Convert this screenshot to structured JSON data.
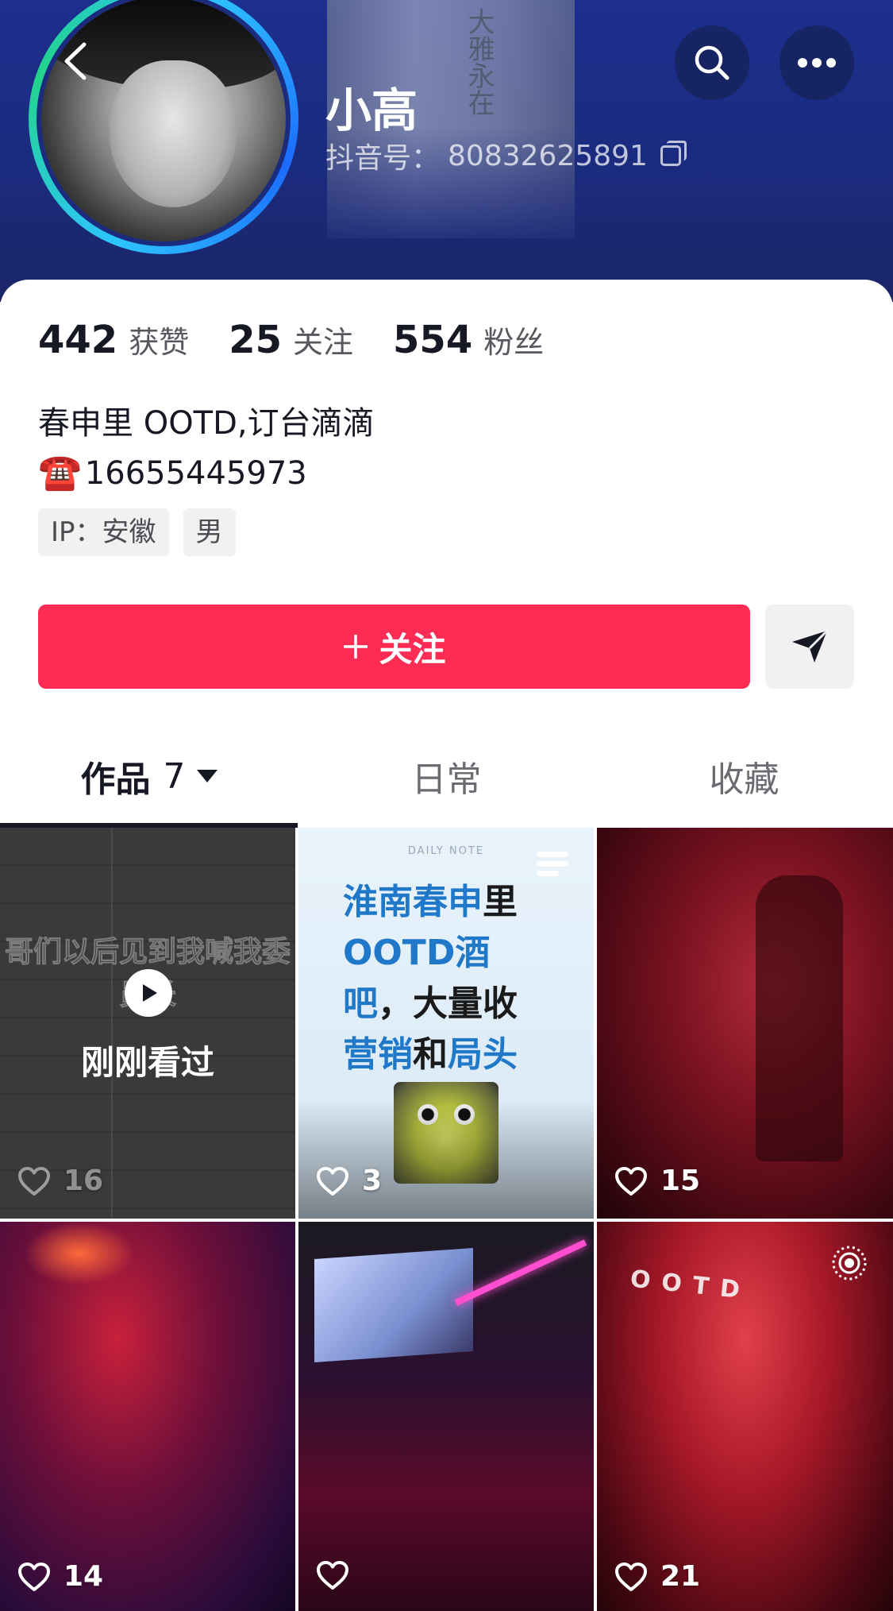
{
  "profile": {
    "nickname": "小高",
    "douyin_id_label": "抖音号：",
    "douyin_id": "80832625891",
    "monument_text": "…"
  },
  "stats": [
    {
      "value": "442",
      "label": "获赞"
    },
    {
      "value": "25",
      "label": "关注"
    },
    {
      "value": "554",
      "label": "粉丝"
    }
  ],
  "bio": {
    "line1": "春申里 OOTD,订台滴滴",
    "phone_icon": "☎️",
    "phone": "16655445973"
  },
  "tags": [
    "IP：安徽",
    "男"
  ],
  "actions": {
    "follow_label": "关注",
    "share_icon": "send-icon"
  },
  "tabs": [
    {
      "label": "作品",
      "count": "7"
    },
    {
      "label": "日常"
    },
    {
      "label": "收藏"
    }
  ],
  "videos": [
    {
      "likes": "16",
      "caption": "哥们以后见到我喊我委员长",
      "overlay": "刚刚看过"
    },
    {
      "likes": "3",
      "tag": "DAILY NOTE",
      "headline_parts": [
        "淮南春申",
        "里",
        "OOTD酒",
        "吧",
        "，大量收",
        "营销",
        "和",
        "局头"
      ]
    },
    {
      "likes": "15"
    },
    {
      "likes": "14"
    },
    {
      "likes": ""
    },
    {
      "likes": "21",
      "banner": "OOTD"
    }
  ],
  "colors": {
    "header_bg": "#1b2b7e",
    "follow_button": "#fe2c55",
    "highlight_blue": "#1f78c8"
  }
}
